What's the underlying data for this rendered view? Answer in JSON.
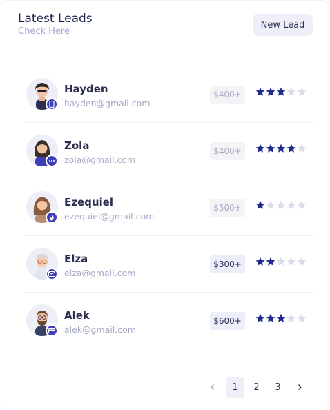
{
  "header": {
    "title": "Latest Leads",
    "subtitle": "Check Here",
    "new_button": "New Lead"
  },
  "leads": [
    {
      "name": "Hayden",
      "email": "hayden@gmail.com",
      "amount": "$400+",
      "rating": 3,
      "badge_icon": "phone-icon",
      "highlight": false
    },
    {
      "name": "Zola",
      "email": "zola@gmail.com",
      "amount": "$400+",
      "rating": 4,
      "badge_icon": "chat-icon",
      "highlight": false
    },
    {
      "name": "Ezequiel",
      "email": "ezequiel@gmail.com",
      "amount": "$500+",
      "rating": 1,
      "badge_icon": "fire-icon",
      "highlight": false
    },
    {
      "name": "Elza",
      "email": "elza@gmail.com",
      "amount": "$300+",
      "rating": 2,
      "badge_icon": "mail-icon",
      "highlight": true
    },
    {
      "name": "Alek",
      "email": "alek@gmail.com",
      "amount": "$600+",
      "rating": 3,
      "badge_icon": "card-icon",
      "highlight": true
    }
  ],
  "rating_max": 5,
  "pagination": {
    "pages": [
      "1",
      "2",
      "3"
    ],
    "current": "1"
  },
  "colors": {
    "star_on": "#1f2a8e",
    "star_off": "#dadde8",
    "accent": "#3f3fb5"
  }
}
